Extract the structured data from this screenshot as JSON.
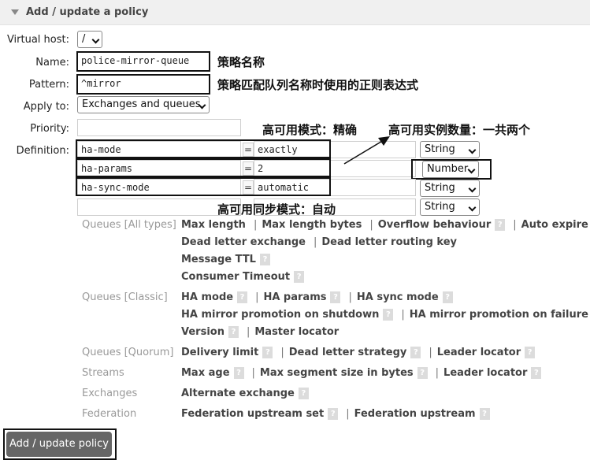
{
  "header": {
    "title": "Add / update a policy"
  },
  "form": {
    "virtual_host": {
      "label": "Virtual host:",
      "value": "/"
    },
    "name": {
      "label": "Name:",
      "value": "police-mirror-queue"
    },
    "pattern": {
      "label": "Pattern:",
      "value": "^mirror"
    },
    "apply_to": {
      "label": "Apply to:",
      "value": "Exchanges and queues"
    },
    "priority": {
      "label": "Priority:",
      "value": ""
    },
    "definition": {
      "label": "Definition:",
      "rows": [
        {
          "key": "ha-mode",
          "eq": "=",
          "value": "exactly",
          "type": "String"
        },
        {
          "key": "ha-params",
          "eq": "=",
          "value": "2",
          "type": "Number"
        },
        {
          "key": "ha-sync-mode",
          "eq": "=",
          "value": "automatic",
          "type": "String"
        },
        {
          "key": "",
          "eq": "",
          "value": "",
          "type": "String"
        }
      ]
    }
  },
  "annotations": {
    "name_note": "策略名称",
    "pattern_note": "策略匹配队列名称时使用的正则表达式",
    "mode_note": "高可用模式：精确",
    "count_note": "高可用实例数量：一共两个",
    "sync_note": "高可用同步模式：自动"
  },
  "help_mark": "?",
  "sep": "|",
  "categories": [
    {
      "name": "Queues [All types]",
      "lines": [
        [
          {
            "k": "Max length",
            "h": false
          },
          {
            "k": "Max length bytes",
            "h": false
          },
          {
            "k": "Overflow behaviour",
            "h": true
          },
          {
            "k": "Auto expire",
            "h": false
          }
        ],
        [
          {
            "k": "Dead letter exchange",
            "h": false
          },
          {
            "k": "Dead letter routing key",
            "h": false
          }
        ],
        [
          {
            "k": "Message TTL",
            "h": true
          }
        ],
        [
          {
            "k": "Consumer Timeout",
            "h": true
          }
        ]
      ]
    },
    {
      "name": "Queues [Classic]",
      "lines": [
        [
          {
            "k": "HA mode",
            "h": true
          },
          {
            "k": "HA params",
            "h": true
          },
          {
            "k": "HA sync mode",
            "h": true
          }
        ],
        [
          {
            "k": "HA mirror promotion on shutdown",
            "h": true
          },
          {
            "k": "HA mirror promotion on failure",
            "h": true
          }
        ],
        [
          {
            "k": "Version",
            "h": true
          },
          {
            "k": "Master locator",
            "h": false
          }
        ]
      ]
    },
    {
      "name": "Queues [Quorum]",
      "lines": [
        [
          {
            "k": "Delivery limit",
            "h": true
          },
          {
            "k": "Dead letter strategy",
            "h": true
          },
          {
            "k": "Leader locator",
            "h": true
          }
        ]
      ]
    },
    {
      "name": "Streams",
      "lines": [
        [
          {
            "k": "Max age",
            "h": true
          },
          {
            "k": "Max segment size in bytes",
            "h": true
          },
          {
            "k": "Leader locator",
            "h": true
          }
        ]
      ]
    },
    {
      "name": "Exchanges",
      "lines": [
        [
          {
            "k": "Alternate exchange",
            "h": true
          }
        ]
      ]
    },
    {
      "name": "Federation",
      "lines": [
        [
          {
            "k": "Federation upstream set",
            "h": true
          },
          {
            "k": "Federation upstream",
            "h": true
          }
        ]
      ]
    }
  ],
  "submit_label": "Add / update policy"
}
